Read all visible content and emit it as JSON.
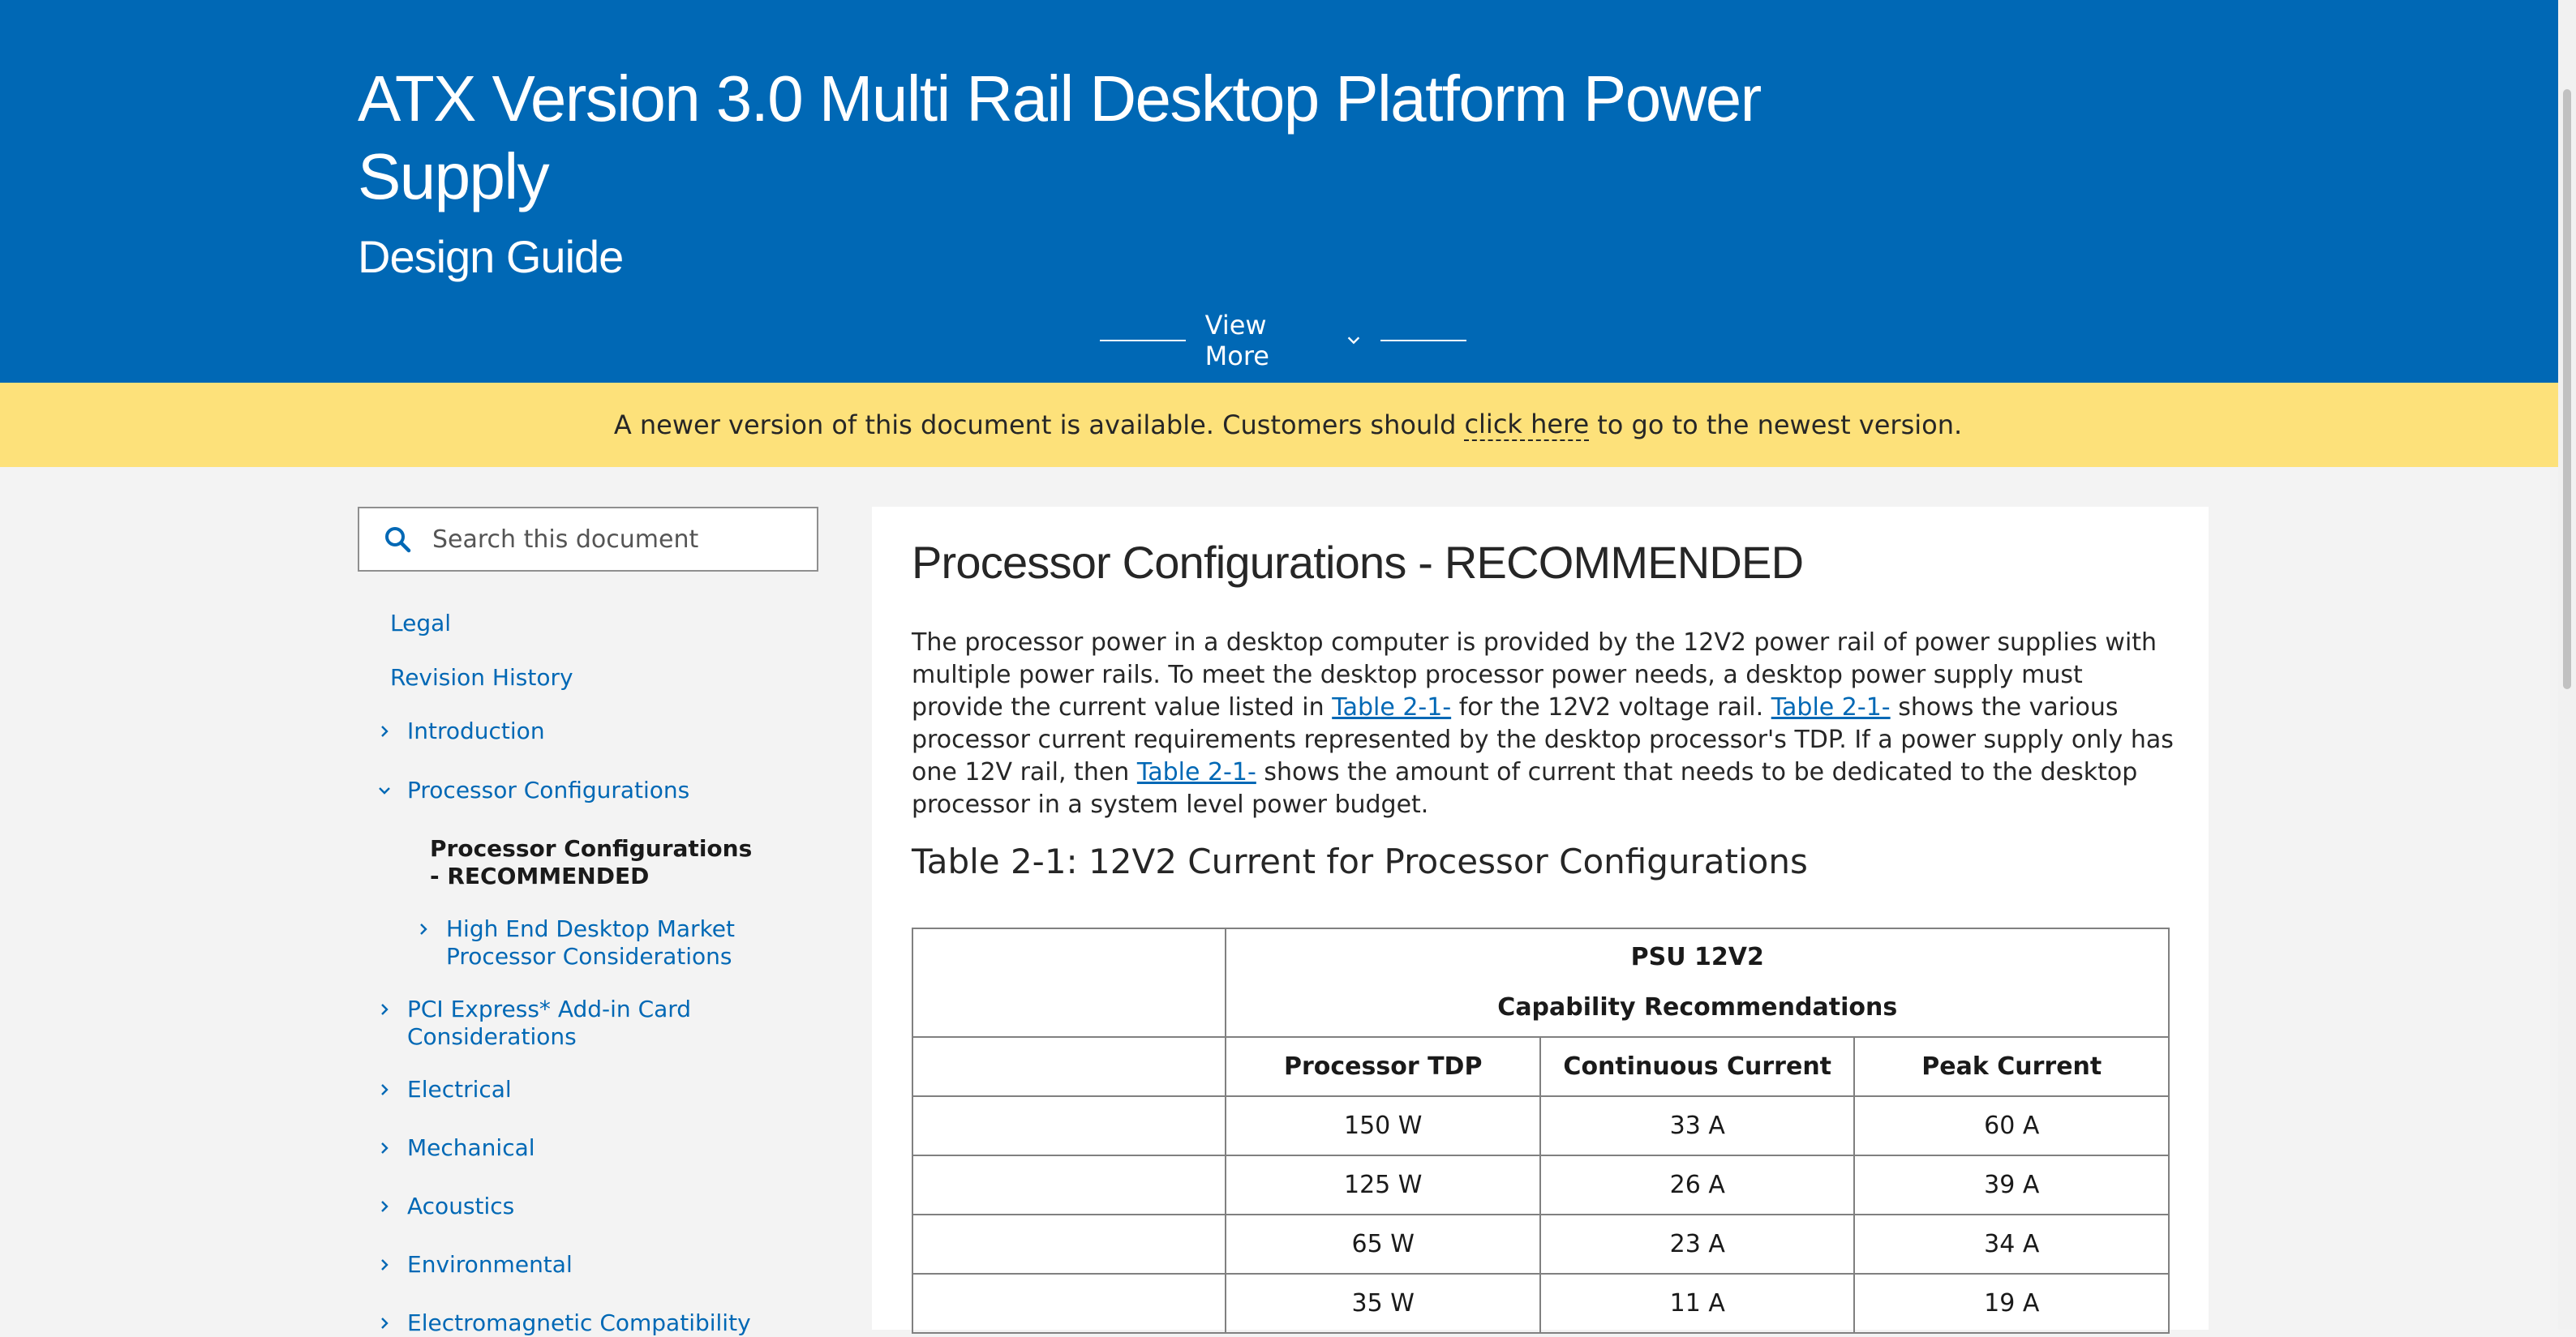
{
  "header": {
    "title": "ATX Version 3.0 Multi Rail Desktop Platform Power Supply",
    "subtitle": "Design Guide",
    "view_more": "View More"
  },
  "banner": {
    "text_before": "A newer version of this document is available. Customers should",
    "link": "click here",
    "text_after": "to go to the newest version."
  },
  "search": {
    "placeholder": "Search this document"
  },
  "toc": [
    {
      "label": "Legal",
      "chevron": "none"
    },
    {
      "label": "Revision History",
      "chevron": "none"
    },
    {
      "label": "Introduction",
      "chevron": "right"
    },
    {
      "label": "Processor Configurations",
      "chevron": "down"
    },
    {
      "label": "Processor Configurations - RECOMMENDED",
      "chevron": "none",
      "active": true
    },
    {
      "label": "High End Desktop Market Processor Considerations",
      "chevron": "right"
    },
    {
      "label": "PCI Express* Add-in Card Considerations",
      "chevron": "right"
    },
    {
      "label": "Electrical",
      "chevron": "right"
    },
    {
      "label": "Mechanical",
      "chevron": "right"
    },
    {
      "label": "Acoustics",
      "chevron": "right"
    },
    {
      "label": "Environmental",
      "chevron": "right"
    },
    {
      "label": "Electromagnetic Compatibility",
      "chevron": "right"
    }
  ],
  "content": {
    "heading": "Processor Configurations - RECOMMENDED",
    "paragraph": {
      "t1": "The processor power in a desktop computer is provided by the 12V2 power rail of power supplies with multiple power rails. To meet the desktop processor power needs, a desktop power supply must provide the current value listed in",
      "link1": "Table 2-1-",
      "t2": "for the 12V2 voltage rail.",
      "link2": "Table 2-1-",
      "t3": "shows the various processor current requirements represented by the desktop processor's TDP. If a power supply only has one 12V rail, then",
      "link3": "Table 2-1-",
      "t4": "shows the amount of current that needs to be dedicated to the desktop processor in a system level power budget."
    },
    "table_caption": "Table 2-1: 12V2 Current for Processor Configurations",
    "table": {
      "group_header_1": "PSU 12V2",
      "group_header_2": "Capability Recommendations",
      "columns": [
        "",
        "Processor TDP",
        "Continuous Current",
        "Peak Current"
      ],
      "rows": [
        [
          "",
          "150 W",
          "33 A",
          "60 A"
        ],
        [
          "",
          "125 W",
          "26 A",
          "39 A"
        ],
        [
          "",
          "65 W",
          "23 A",
          "34 A"
        ],
        [
          "",
          "35 W",
          "11 A",
          "19 A"
        ]
      ]
    }
  },
  "colors": {
    "brand_blue": "#0068b5",
    "banner_yellow": "#fde17a",
    "page_bg": "#f3f3f3"
  }
}
